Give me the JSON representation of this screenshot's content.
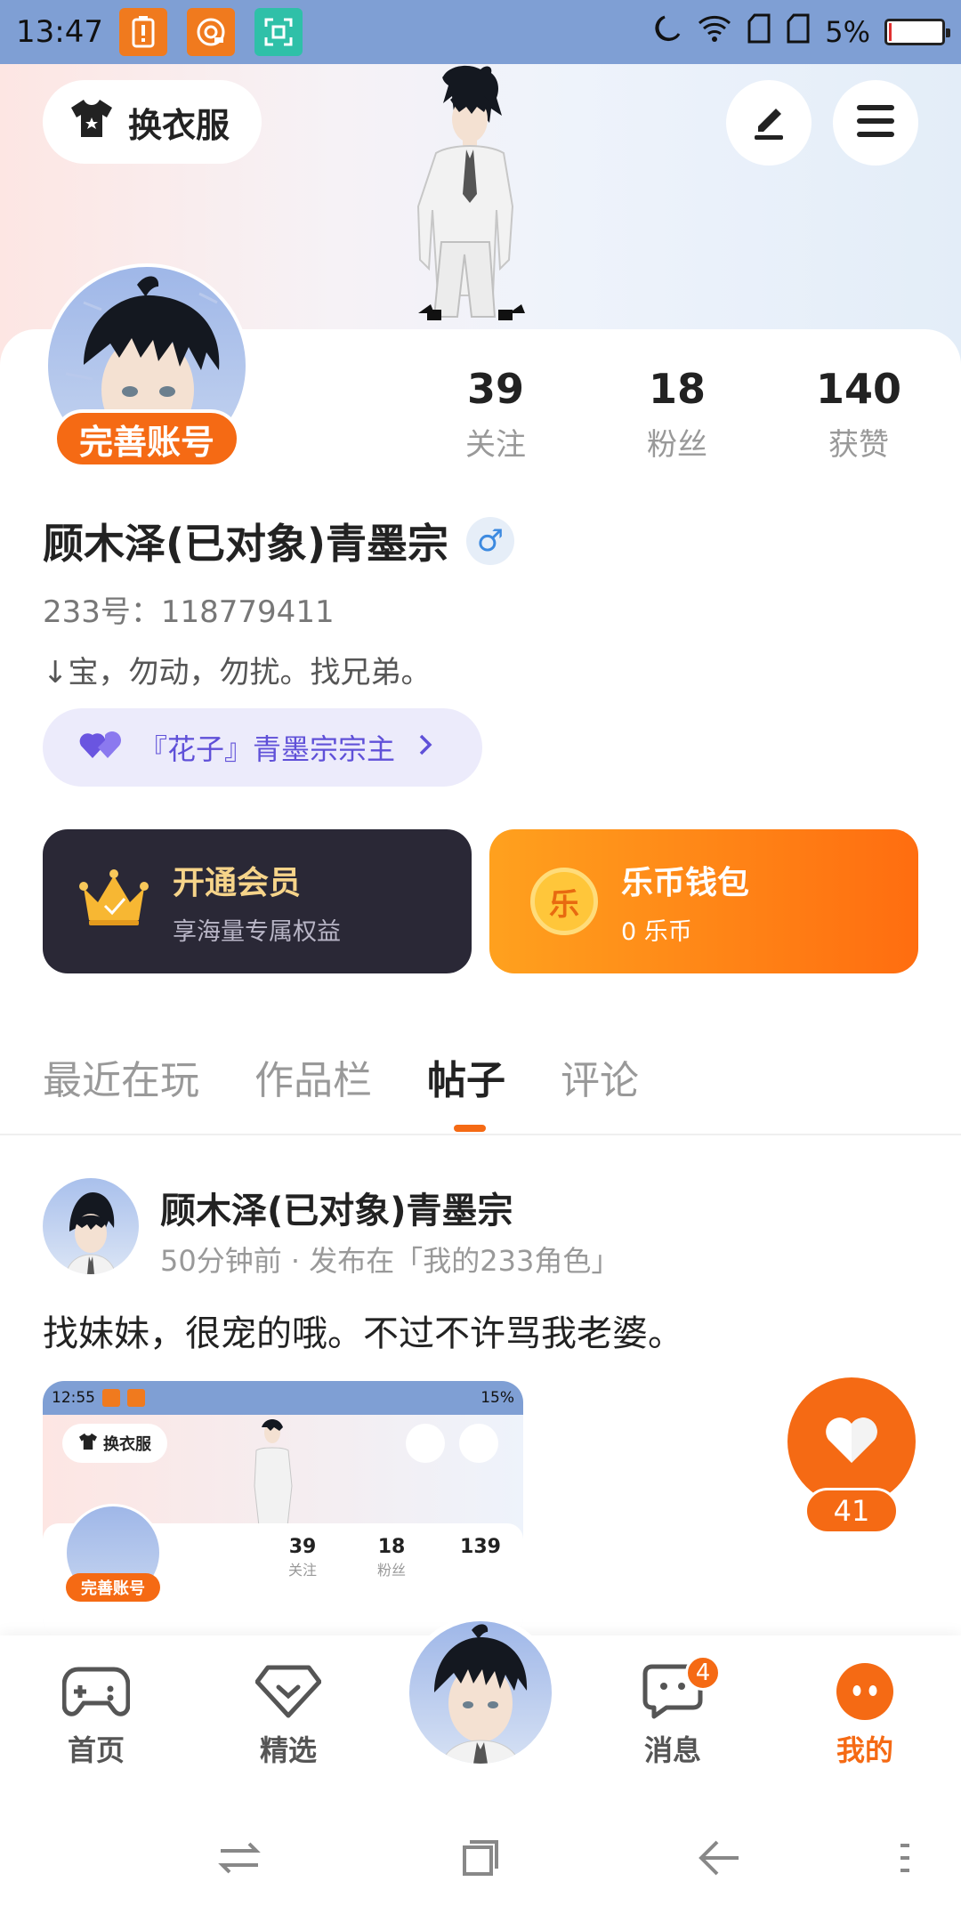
{
  "status_bar": {
    "time": "13:47",
    "battery_text": "5%",
    "icons": [
      "battery-alert-icon",
      "notification-app-icon",
      "scan-icon",
      "moon-icon",
      "wifi-icon",
      "sim1-icon",
      "sim2-icon",
      "battery-icon"
    ]
  },
  "header": {
    "outfit_label": "换衣服",
    "edit_icon": "pen-icon",
    "menu_icon": "menu-icon"
  },
  "profile": {
    "complete_badge": "完善账号",
    "stats": [
      {
        "num": "39",
        "label": "关注"
      },
      {
        "num": "18",
        "label": "粉丝"
      },
      {
        "num": "140",
        "label": "获赞"
      }
    ],
    "username": "顾木泽(已对象)青墨宗",
    "gender_symbol": "♂",
    "uid": "233号：118779411",
    "bio": "↓宝，勿动，勿扰。找兄弟。",
    "sect_tag": "『花子』青墨宗宗主"
  },
  "vip": {
    "title": "开通会员",
    "subtitle": "享海量专属权益"
  },
  "wallet": {
    "title": "乐币钱包",
    "subtitle": "0 乐币",
    "coin_char": "乐"
  },
  "tabs": [
    "最近在玩",
    "作品栏",
    "帖子",
    "评论"
  ],
  "active_tab": "帖子",
  "post": {
    "author": "顾木泽(已对象)青墨宗",
    "meta": "50分钟前 · 发布在「我的233角色」",
    "text": "找妹妹，很宠的哦。不过不许骂我老婆。",
    "likes": "41",
    "thumb": {
      "time": "12:55",
      "battery": "15%",
      "outfit_label": "换衣服",
      "badge": "完善账号",
      "stats": [
        {
          "num": "39",
          "label": "关注"
        },
        {
          "num": "18",
          "label": "粉丝"
        },
        {
          "num": "139",
          "label": ""
        }
      ]
    }
  },
  "bottom_nav": {
    "items": [
      {
        "label": "首页",
        "icon": "gamepad-icon"
      },
      {
        "label": "精选",
        "icon": "heart-gem-icon"
      },
      {
        "label": "消息",
        "icon": "chat-icon",
        "badge": "4"
      },
      {
        "label": "我的",
        "icon": "profile-face-icon"
      }
    ]
  },
  "colors": {
    "accent": "#f56a14",
    "status_bar": "#7f9fd4",
    "sect_text": "#5f50d8",
    "vip_bg": "#2a2836"
  }
}
